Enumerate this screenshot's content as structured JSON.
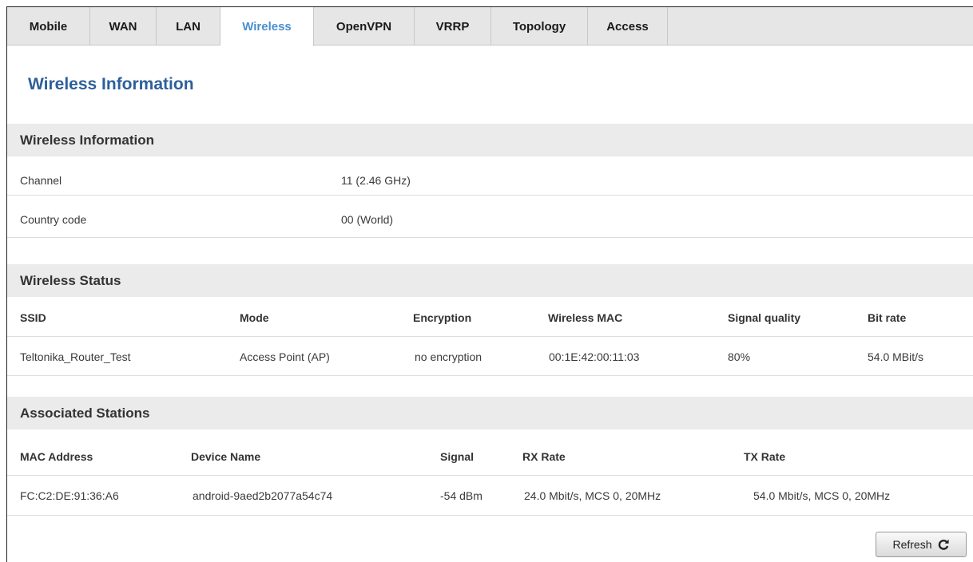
{
  "tabs": [
    {
      "label": "Mobile"
    },
    {
      "label": "WAN"
    },
    {
      "label": "LAN"
    },
    {
      "label": "Wireless",
      "active": true
    },
    {
      "label": "OpenVPN"
    },
    {
      "label": "VRRP"
    },
    {
      "label": "Topology"
    },
    {
      "label": "Access"
    }
  ],
  "page_title": "Wireless Information",
  "wireless_info": {
    "heading": "Wireless Information",
    "rows": [
      {
        "label": "Channel",
        "value": "11 (2.46 GHz)"
      },
      {
        "label": "Country code",
        "value": "00 (World)"
      }
    ]
  },
  "wireless_status": {
    "heading": "Wireless Status",
    "headers": [
      "SSID",
      "Mode",
      "Encryption",
      "Wireless MAC",
      "Signal quality",
      "Bit rate"
    ],
    "row": [
      "Teltonika_Router_Test",
      "Access Point (AP)",
      "no encryption",
      "00:1E:42:00:11:03",
      "80%",
      "54.0 MBit/s"
    ]
  },
  "associated": {
    "heading": "Associated Stations",
    "headers": [
      "MAC Address",
      "Device Name",
      "Signal",
      "RX Rate",
      "TX Rate"
    ],
    "row": [
      "FC:C2:DE:91:36:A6",
      "android-9aed2b2077a54c74",
      "-54 dBm",
      "24.0 Mbit/s, MCS 0, 20MHz",
      "54.0 Mbit/s, MCS 0, 20MHz"
    ]
  },
  "refresh_label": "Refresh",
  "colors": {
    "accent": "#4a8fd0",
    "title": "#2d5f9a",
    "header_bg": "#ebebeb",
    "tabbar_bg": "#e6e6e6"
  }
}
